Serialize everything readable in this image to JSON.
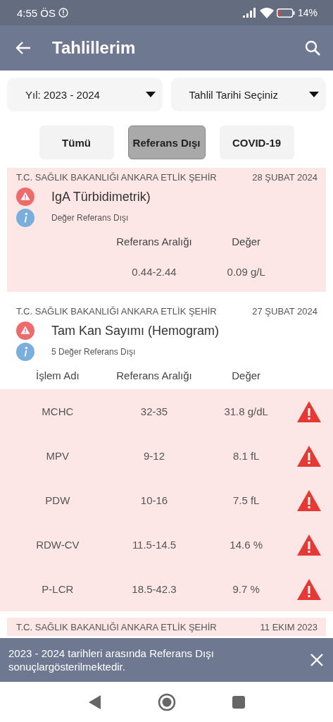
{
  "status_bar": {
    "time": "4:55 ÖS",
    "battery": "14%"
  },
  "app_bar": {
    "title": "Tahlillerim"
  },
  "filters": [
    {
      "label": "Yıl: 2023 - 2024"
    },
    {
      "label": "Tahlil Tarihi Seçiniz"
    }
  ],
  "tabs": [
    {
      "label": "Tümü",
      "selected": false
    },
    {
      "label": "Referans Dışı",
      "selected": true
    },
    {
      "label": "COVID-19",
      "selected": false
    }
  ],
  "cards": [
    {
      "hospital": "T.C. SAĞLIK BAKANLIĞI ANKARA ETLİK ŞEHİR",
      "date": "28 ŞUBAT 2024",
      "highlighted": true,
      "title": "IgA Türbidimetrik)",
      "note": "Değer Referans Dışı",
      "columns": [
        "Referans Aralığı",
        "Değer"
      ],
      "rows": [
        {
          "cells": [
            "0.44-2.44",
            "0.09 g/L"
          ],
          "flagged": false
        }
      ]
    },
    {
      "hospital": "T.C. SAĞLIK BAKANLIĞI ANKARA ETLİK ŞEHİR",
      "date": "27 ŞUBAT 2024",
      "highlighted": false,
      "title": "Tam Kan Sayımı (Hemogram)",
      "note": "5 Değer Referans Dışı",
      "columns": [
        "İşlem Adı",
        "Referans Aralığı",
        "Değer"
      ],
      "rows": [
        {
          "cells": [
            "MCHC",
            "32-35",
            "31.8 g/dL"
          ],
          "flagged": true
        },
        {
          "cells": [
            "MPV",
            "9-12",
            "8.1 fL"
          ],
          "flagged": true
        },
        {
          "cells": [
            "PDW",
            "10-16",
            "7.5 fL"
          ],
          "flagged": true
        },
        {
          "cells": [
            "RDW-CV",
            "11.5-14.5",
            "14.6 %"
          ],
          "flagged": true
        },
        {
          "cells": [
            "P-LCR",
            "18.5-42.3",
            "9.7 %"
          ],
          "flagged": true
        }
      ]
    },
    {
      "hospital": "T.C. SAĞLIK BAKANLIĞI ANKARA ETLİK ŞEHİR",
      "date": "11 EKIM 2023",
      "highlighted": true
    }
  ],
  "snackbar": {
    "message": "2023 - 2024 tarihleri arasında Referans Dışı sonuçlargösterilmektedir."
  }
}
